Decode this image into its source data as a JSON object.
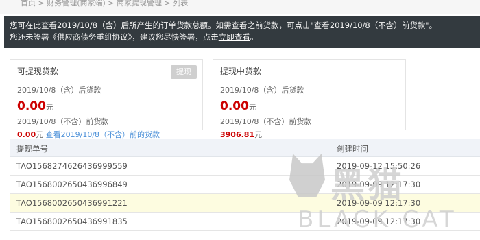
{
  "breadcrumb": "首页 > 财务管理(商家端) > 商家提现管理 > 列表",
  "notice": {
    "line1": "您可在此查看2019/10/8（含）后所产生的订单货款总额。如需查看之前货款，可点击\"查看2019/10/8（不含）前货款\"。",
    "line2_prefix": "您还未签署《供应商债务重组协议》，建议您尽快签署，点击",
    "line2_link": "立即查看",
    "line2_suffix": "。"
  },
  "card_withdrawable": {
    "title": "可提现货款",
    "button": "提现",
    "after_label": "2019/10/8（含）后货款",
    "after_amount": "0.00",
    "unit": "元",
    "before_label": "2019/10/8（不含）前货款",
    "before_amount": "0.00",
    "before_link": "查看2019/10/8（不含）前的货款"
  },
  "card_pending": {
    "title": "提现中货款",
    "after_label": "2019/10/8（含）后货款",
    "after_amount": "0.00",
    "unit": "元",
    "before_label": "2019/10/8（不含）前货款",
    "before_amount": "3906.81"
  },
  "table": {
    "headers": [
      "提现单号",
      "创建时间"
    ],
    "rows": [
      {
        "id": "TAO1568274626436999559",
        "time": "2019-09-12 15:50:26"
      },
      {
        "id": "TAO1568002650436996849",
        "time": "2019-09-09 12:17:30"
      },
      {
        "id": "TAO1568002650436991221",
        "time": "2019-09-09 12:17:30"
      },
      {
        "id": "TAO1568002650436991835",
        "time": "2019-09-09 12:17:30"
      }
    ]
  },
  "watermark": {
    "cn": "黑猫",
    "en": "BLACK CAT"
  }
}
